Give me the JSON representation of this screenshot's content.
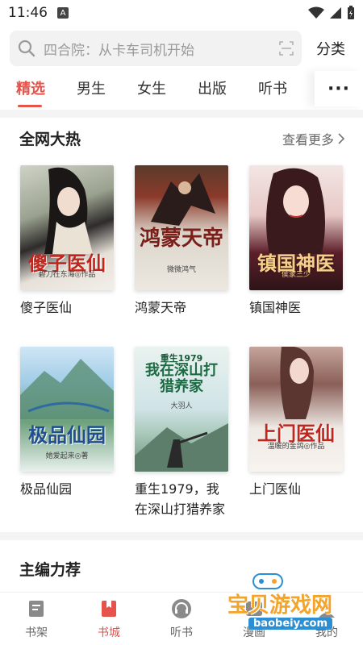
{
  "status": {
    "time": "11:46",
    "notif_letter": "A"
  },
  "search": {
    "placeholder": "四合院：从卡车司机开始",
    "category_label": "分类"
  },
  "tabs": [
    {
      "label": "精选",
      "active": true
    },
    {
      "label": "男生"
    },
    {
      "label": "女生"
    },
    {
      "label": "出版"
    },
    {
      "label": "听书"
    }
  ],
  "hot": {
    "title": "全网大热",
    "more_label": "查看更多",
    "books": [
      {
        "title": "傻子医仙",
        "cover_text": "傻子医仙",
        "cover_author": "碧刀在东海◎作品"
      },
      {
        "title": "鸿蒙天帝",
        "cover_text": "鸿蒙天帝",
        "cover_author": "微微鸿气"
      },
      {
        "title": "镇国神医",
        "cover_text": "镇国神医",
        "cover_author": "侯家三少"
      },
      {
        "title": "极品仙园",
        "cover_text": "极品仙园",
        "cover_author": "她爱起来◎著"
      },
      {
        "title": "重生1979，我在深山打猎养家",
        "cover_text": "我在深山打猎养家",
        "cover_sub": "重生1979",
        "cover_author": "大羽人"
      },
      {
        "title": "上门医仙",
        "cover_text": "上门医仙",
        "cover_author": "温暖的金鸽◎作品"
      }
    ]
  },
  "editor": {
    "title": "主编力荐"
  },
  "bottom_nav": [
    {
      "label": "书架",
      "icon": "bookshelf-icon"
    },
    {
      "label": "书城",
      "icon": "bookstore-icon",
      "active": true
    },
    {
      "label": "听书",
      "icon": "headphones-icon"
    },
    {
      "label": "漫画",
      "icon": "comic-icon"
    },
    {
      "label": "我的",
      "icon": "profile-icon"
    }
  ],
  "watermark": {
    "text": "宝贝游戏网",
    "url": "baobeiy.com"
  },
  "colors": {
    "accent": "#e5534b",
    "placeholder": "#9a9a9a",
    "band": "#f4f4f4"
  }
}
